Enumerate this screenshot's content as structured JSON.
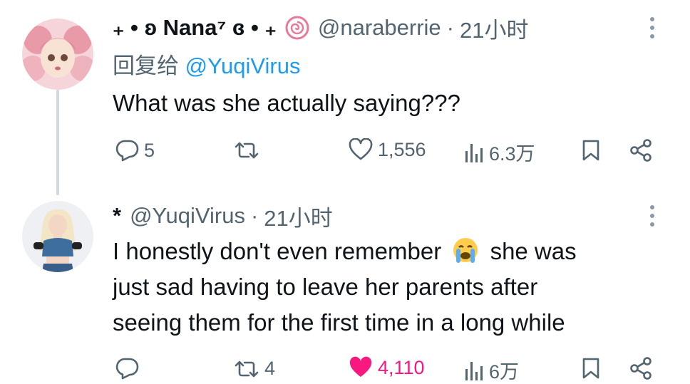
{
  "tweet1": {
    "display_name": "₊ • ʚ Nana⁷ ɞ • ₊",
    "handle": "@naraberrie",
    "separator": "·",
    "time": "21小时",
    "reply_prefix": "回复给",
    "reply_to": "@YuqiVirus",
    "text": "What was she actually saying???",
    "actions": {
      "replies": "5",
      "retweets": "",
      "likes": "1,556",
      "views": "6.3万"
    }
  },
  "tweet2": {
    "display_name": "*",
    "handle": "@YuqiVirus",
    "separator": "·",
    "time": "21小时",
    "text_part1": "I honestly don't even remember",
    "text_part2": "she was",
    "text_line2": "just sad having to leave her parents after",
    "text_line3": "seeing them for the first time in a long while",
    "actions": {
      "replies": "",
      "retweets": "4",
      "likes": "4,110",
      "views": "6万"
    }
  },
  "colors": {
    "text": "#0f1419",
    "muted": "#536471",
    "link": "#1d9bf0",
    "like": "#f91880",
    "thread_line": "#cfd9de"
  },
  "icons": [
    "reply-icon",
    "retweet-icon",
    "like-icon",
    "views-icon",
    "bookmark-icon",
    "share-icon",
    "more-icon",
    "crying-emoji"
  ]
}
